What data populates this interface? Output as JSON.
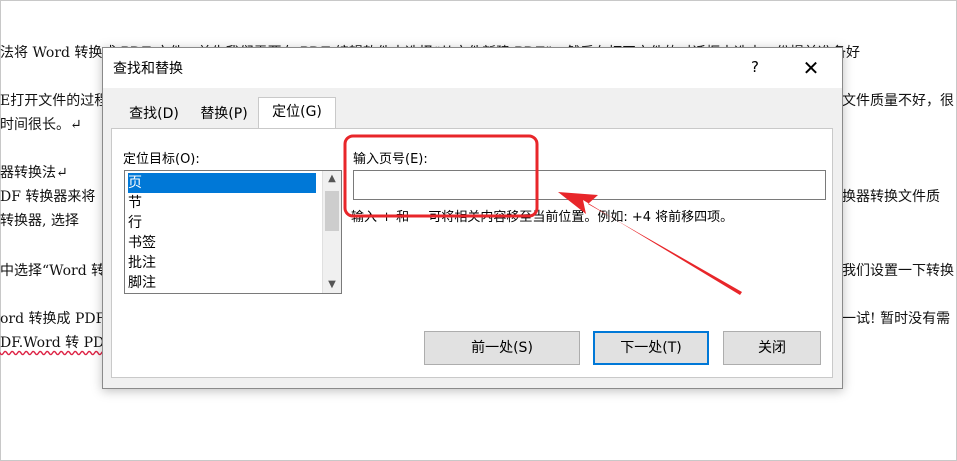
{
  "document": {
    "lines": [
      "法将 Word 转换成 PDF 文件，首先我们需要在 PDF 编辑软件中选择“从文件新建 PDF”，然后在打开文件的对话框中选中一份提前准备好",
      "E打开文件的过程中",
      "文件质量不好，很",
      "时间很长。↵",
      "器转换法↵",
      "DF 转换器来将",
      "换器转换文件质",
      "转换器, 选择",
      "中选择“Word 转",
      "我们设置一下转换",
      "ord 转换成 PDF",
      "一试! 暂时没有需",
      "DF.Word 转 PDF"
    ]
  },
  "dialog": {
    "title": "查找和替换",
    "help": "?",
    "close": "✕",
    "tabs": [
      {
        "label": "查找(D)"
      },
      {
        "label": "替换(P)"
      },
      {
        "label": "定位(G)"
      }
    ],
    "goto_target_label": "定位目标(O):",
    "goto_targets": [
      "页",
      "节",
      "行",
      "书签",
      "批注",
      "脚注"
    ],
    "selected_target": "页",
    "page_number_label": "输入页号(E):",
    "page_number_value": "",
    "hint": "输入 + 和 − 可将相关内容移至当前位置。例如: +4 将前移四项。",
    "buttons": {
      "previous": "前一处(S)",
      "next": "下一处(T)",
      "close": "关闭"
    }
  },
  "annotation": {
    "color": "#e8262a"
  }
}
